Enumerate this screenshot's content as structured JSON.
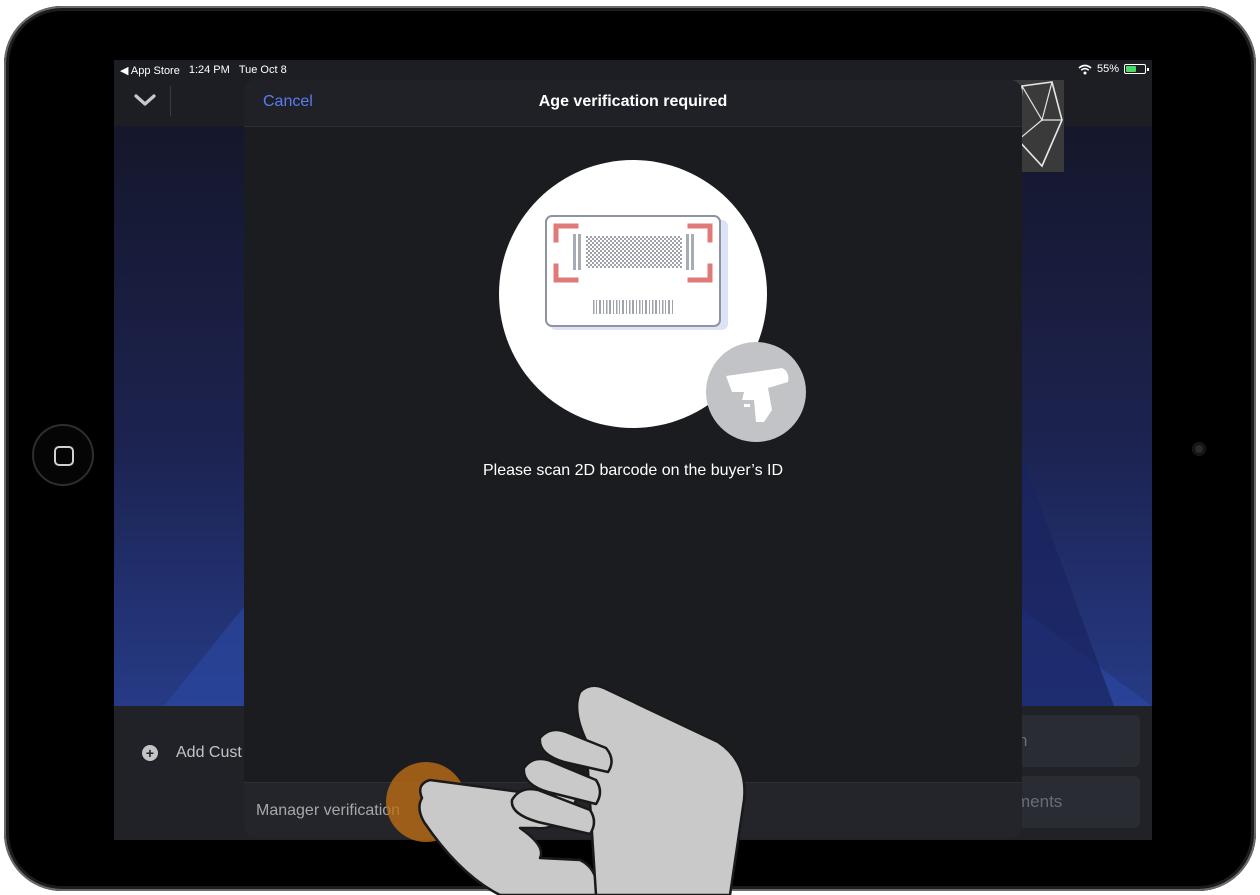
{
  "status_bar": {
    "back_app": "App Store",
    "time": "1:24 PM",
    "date": "Tue Oct 8",
    "battery": "55%",
    "battery_level": 0.55
  },
  "background": {
    "add_customer_label": "Add Cust",
    "button_1_label": "n",
    "button_2_label": "ments"
  },
  "modal": {
    "cancel_label": "Cancel",
    "title": "Age verification required",
    "instruction": "Please scan 2D barcode on the buyer’s ID",
    "footer_button": "Manager verification"
  },
  "icons": {
    "chevron": "chevron-down-icon",
    "add": "plus-circle-icon",
    "scanner": "barcode-scanner-icon",
    "id_card": "id-card-icon",
    "hand": "tap-hand-icon",
    "wifi": "wifi-icon",
    "battery": "battery-icon"
  },
  "colors": {
    "accent": "#5a7df0",
    "scan_frame": "#e07a78",
    "battery_fill": "#4cd964",
    "tap_indicator": "#be6e14"
  }
}
